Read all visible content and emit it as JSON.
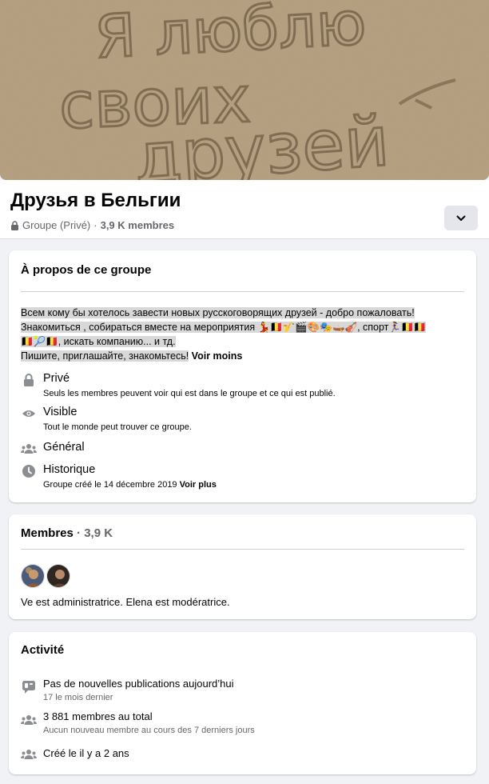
{
  "cover": {
    "text_lines": [
      "Я люблю",
      "своих",
      "друзей"
    ]
  },
  "group": {
    "name": "Друзья в Бельгии",
    "privacy": "Groupe (Privé)",
    "separator": "·",
    "members_count": "3,9 K membres"
  },
  "about": {
    "title": "À propos de ce groupe",
    "description_line1": "Всем кому бы хотелось завести новых русскоговорящих друзей - добро пожаловать!",
    "description_line2_a": "Знакомиться , собираться вместе на мероприятия 💃🇧🇪🎷🎬🎨🎭🛶🎻, спорт🏃‍♀️🇧🇪🇧🇪",
    "description_line3": "🇧🇪🎾🇧🇪, искать компанию... и тд.",
    "description_line4": "Пишите, приглашайте, знакомьтесь!",
    "see_less": "Voir moins",
    "items": [
      {
        "icon": "lock-icon",
        "title": "Privé",
        "subtitle": "Seuls les membres peuvent voir qui est dans le groupe et ce qui est publié."
      },
      {
        "icon": "eye-icon",
        "title": "Visible",
        "subtitle": "Tout le monde peut trouver ce groupe."
      },
      {
        "icon": "people-icon",
        "title": "Général",
        "subtitle": ""
      },
      {
        "icon": "clock-icon",
        "title": "Historique",
        "subtitle": "Groupe créé le 14 décembre 2019",
        "link": "Voir plus"
      }
    ]
  },
  "members": {
    "title": "Membres",
    "separator": "·",
    "count": "3,9 K",
    "admins_text": "Ve est administratrice. Elena est modératrice."
  },
  "activity": {
    "title": "Activité",
    "items": [
      {
        "icon": "chat-icon",
        "title": "Pas de nouvelles publications aujourd’hui",
        "subtitle": "17 le mois dernier"
      },
      {
        "icon": "people-icon",
        "title": "3 881 membres au total",
        "subtitle": "Aucun nouveau membre au cours des 7 derniers jours"
      },
      {
        "icon": "people-icon",
        "title": "Créé le il y a 2 ans",
        "subtitle": ""
      }
    ]
  },
  "colors": {
    "page_bg": "#f0f2f5",
    "card_bg": "#ffffff",
    "secondary_text": "#65676b",
    "icon_gray": "#8a8d91",
    "highlight": "#d8d8d8"
  }
}
